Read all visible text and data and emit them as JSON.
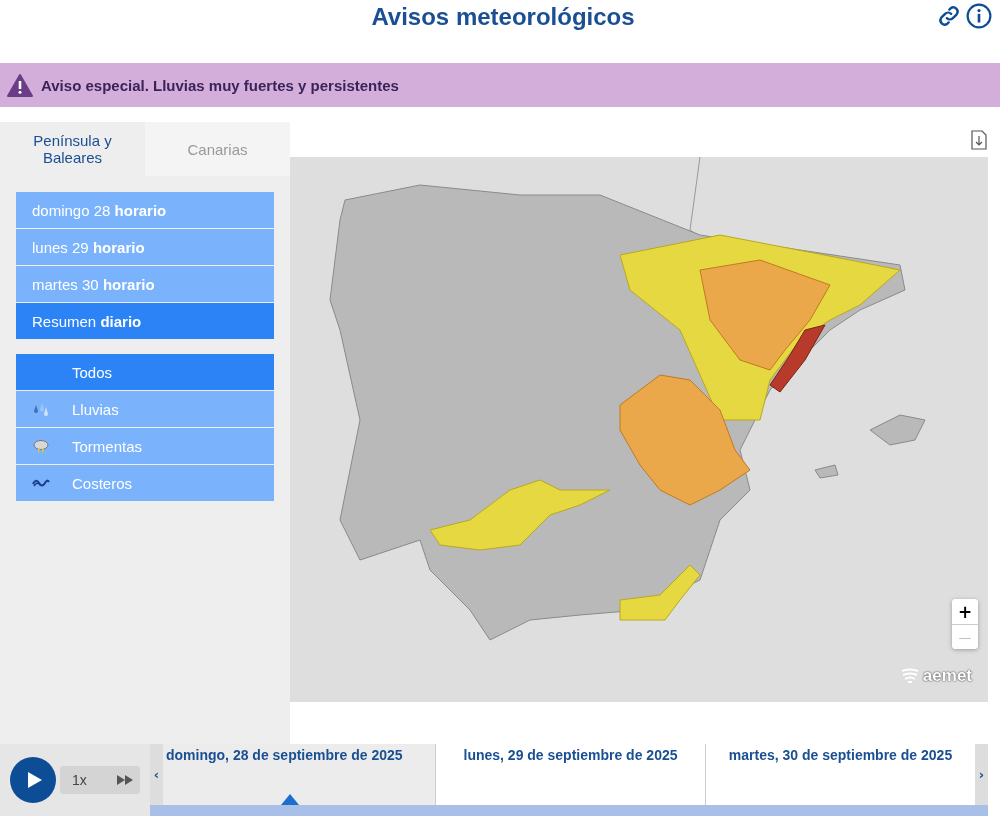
{
  "header": {
    "title": "Avisos meteorológicos"
  },
  "banner": {
    "text": "Aviso especial. Lluvias muy fuertes y persistentes"
  },
  "region_tabs": [
    {
      "label": "Península y Baleares",
      "selected": true
    },
    {
      "label": "Canarias",
      "selected": false
    }
  ],
  "day_menu": [
    {
      "label": "domingo 28 **horario**",
      "selected": false
    },
    {
      "label": "lunes 29 **horario**",
      "selected": false
    },
    {
      "label": "martes 30 **horario**",
      "selected": false
    },
    {
      "label": "Resumen **diario**",
      "selected": true
    }
  ],
  "filters": [
    {
      "label": "Todos",
      "kind": "all",
      "selected": true
    },
    {
      "label": "Lluvias",
      "kind": "rain",
      "selected": false
    },
    {
      "label": "Tormentas",
      "kind": "storm",
      "selected": false
    },
    {
      "label": "Costeros",
      "kind": "coastal",
      "selected": false
    }
  ],
  "map": {
    "zoom_in": {
      "label": "+",
      "disabled": false
    },
    "zoom_out": {
      "label": "—",
      "disabled": true
    },
    "logo": "aemet"
  },
  "player": {
    "speed": "1x"
  },
  "timeline": {
    "prev": "‹",
    "next": "›",
    "days": [
      {
        "label": "domingo, 28 de septiembre de 2025",
        "selected": true
      },
      {
        "label": "lunes, 29 de septiembre de 2025",
        "selected": false
      },
      {
        "label": "martes, 30 de septiembre de 2025",
        "selected": false
      }
    ]
  }
}
